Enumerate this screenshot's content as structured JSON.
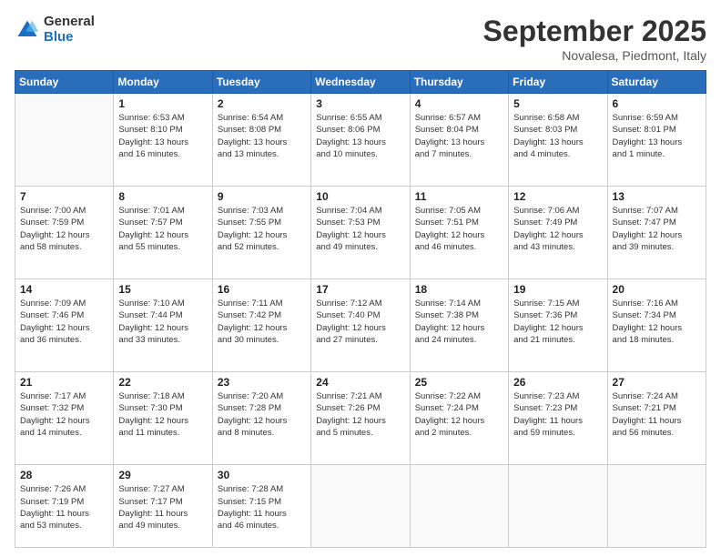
{
  "logo": {
    "general": "General",
    "blue": "Blue"
  },
  "title": {
    "month_year": "September 2025",
    "location": "Novalesa, Piedmont, Italy"
  },
  "days_of_week": [
    "Sunday",
    "Monday",
    "Tuesday",
    "Wednesday",
    "Thursday",
    "Friday",
    "Saturday"
  ],
  "weeks": [
    [
      {
        "day": "",
        "info": ""
      },
      {
        "day": "1",
        "info": "Sunrise: 6:53 AM\nSunset: 8:10 PM\nDaylight: 13 hours\nand 16 minutes."
      },
      {
        "day": "2",
        "info": "Sunrise: 6:54 AM\nSunset: 8:08 PM\nDaylight: 13 hours\nand 13 minutes."
      },
      {
        "day": "3",
        "info": "Sunrise: 6:55 AM\nSunset: 8:06 PM\nDaylight: 13 hours\nand 10 minutes."
      },
      {
        "day": "4",
        "info": "Sunrise: 6:57 AM\nSunset: 8:04 PM\nDaylight: 13 hours\nand 7 minutes."
      },
      {
        "day": "5",
        "info": "Sunrise: 6:58 AM\nSunset: 8:03 PM\nDaylight: 13 hours\nand 4 minutes."
      },
      {
        "day": "6",
        "info": "Sunrise: 6:59 AM\nSunset: 8:01 PM\nDaylight: 13 hours\nand 1 minute."
      }
    ],
    [
      {
        "day": "7",
        "info": "Sunrise: 7:00 AM\nSunset: 7:59 PM\nDaylight: 12 hours\nand 58 minutes."
      },
      {
        "day": "8",
        "info": "Sunrise: 7:01 AM\nSunset: 7:57 PM\nDaylight: 12 hours\nand 55 minutes."
      },
      {
        "day": "9",
        "info": "Sunrise: 7:03 AM\nSunset: 7:55 PM\nDaylight: 12 hours\nand 52 minutes."
      },
      {
        "day": "10",
        "info": "Sunrise: 7:04 AM\nSunset: 7:53 PM\nDaylight: 12 hours\nand 49 minutes."
      },
      {
        "day": "11",
        "info": "Sunrise: 7:05 AM\nSunset: 7:51 PM\nDaylight: 12 hours\nand 46 minutes."
      },
      {
        "day": "12",
        "info": "Sunrise: 7:06 AM\nSunset: 7:49 PM\nDaylight: 12 hours\nand 43 minutes."
      },
      {
        "day": "13",
        "info": "Sunrise: 7:07 AM\nSunset: 7:47 PM\nDaylight: 12 hours\nand 39 minutes."
      }
    ],
    [
      {
        "day": "14",
        "info": "Sunrise: 7:09 AM\nSunset: 7:46 PM\nDaylight: 12 hours\nand 36 minutes."
      },
      {
        "day": "15",
        "info": "Sunrise: 7:10 AM\nSunset: 7:44 PM\nDaylight: 12 hours\nand 33 minutes."
      },
      {
        "day": "16",
        "info": "Sunrise: 7:11 AM\nSunset: 7:42 PM\nDaylight: 12 hours\nand 30 minutes."
      },
      {
        "day": "17",
        "info": "Sunrise: 7:12 AM\nSunset: 7:40 PM\nDaylight: 12 hours\nand 27 minutes."
      },
      {
        "day": "18",
        "info": "Sunrise: 7:14 AM\nSunset: 7:38 PM\nDaylight: 12 hours\nand 24 minutes."
      },
      {
        "day": "19",
        "info": "Sunrise: 7:15 AM\nSunset: 7:36 PM\nDaylight: 12 hours\nand 21 minutes."
      },
      {
        "day": "20",
        "info": "Sunrise: 7:16 AM\nSunset: 7:34 PM\nDaylight: 12 hours\nand 18 minutes."
      }
    ],
    [
      {
        "day": "21",
        "info": "Sunrise: 7:17 AM\nSunset: 7:32 PM\nDaylight: 12 hours\nand 14 minutes."
      },
      {
        "day": "22",
        "info": "Sunrise: 7:18 AM\nSunset: 7:30 PM\nDaylight: 12 hours\nand 11 minutes."
      },
      {
        "day": "23",
        "info": "Sunrise: 7:20 AM\nSunset: 7:28 PM\nDaylight: 12 hours\nand 8 minutes."
      },
      {
        "day": "24",
        "info": "Sunrise: 7:21 AM\nSunset: 7:26 PM\nDaylight: 12 hours\nand 5 minutes."
      },
      {
        "day": "25",
        "info": "Sunrise: 7:22 AM\nSunset: 7:24 PM\nDaylight: 12 hours\nand 2 minutes."
      },
      {
        "day": "26",
        "info": "Sunrise: 7:23 AM\nSunset: 7:23 PM\nDaylight: 11 hours\nand 59 minutes."
      },
      {
        "day": "27",
        "info": "Sunrise: 7:24 AM\nSunset: 7:21 PM\nDaylight: 11 hours\nand 56 minutes."
      }
    ],
    [
      {
        "day": "28",
        "info": "Sunrise: 7:26 AM\nSunset: 7:19 PM\nDaylight: 11 hours\nand 53 minutes."
      },
      {
        "day": "29",
        "info": "Sunrise: 7:27 AM\nSunset: 7:17 PM\nDaylight: 11 hours\nand 49 minutes."
      },
      {
        "day": "30",
        "info": "Sunrise: 7:28 AM\nSunset: 7:15 PM\nDaylight: 11 hours\nand 46 minutes."
      },
      {
        "day": "",
        "info": ""
      },
      {
        "day": "",
        "info": ""
      },
      {
        "day": "",
        "info": ""
      },
      {
        "day": "",
        "info": ""
      }
    ]
  ]
}
